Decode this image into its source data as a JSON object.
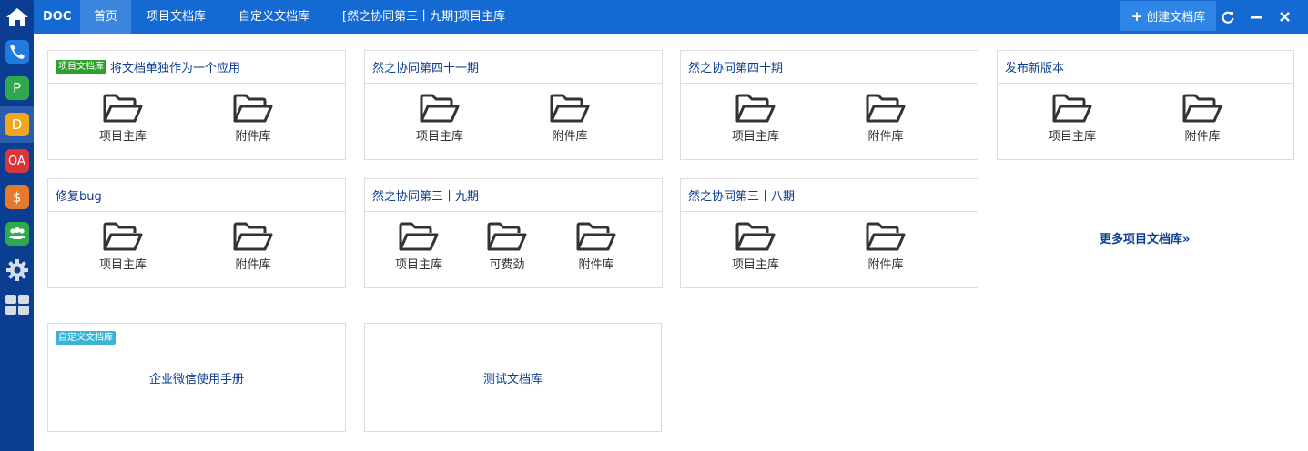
{
  "app": {
    "brand": "DOC"
  },
  "sidebar": {
    "items": [
      {
        "name": "home-icon",
        "label": ""
      },
      {
        "name": "phone-icon",
        "label": "",
        "color": "#1f7be0"
      },
      {
        "name": "p-app-icon",
        "label": "P",
        "color": "#2fa84f"
      },
      {
        "name": "d-app-icon",
        "label": "D",
        "color": "#f0a61e"
      },
      {
        "name": "oa-app-icon",
        "label": "OA",
        "color": "#d9363a"
      },
      {
        "name": "dollar-app-icon",
        "label": "$",
        "color": "#e67a2c"
      },
      {
        "name": "team-app-icon",
        "label": "",
        "color": "#2fa84f"
      },
      {
        "name": "gear-icon",
        "label": ""
      },
      {
        "name": "grid-icon",
        "label": ""
      }
    ]
  },
  "nav": {
    "tabs": [
      {
        "label": "首页",
        "active": true
      },
      {
        "label": "项目文档库",
        "active": false
      },
      {
        "label": "自定义文档库",
        "active": false
      },
      {
        "label": "[然之协同第三十九期]项目主库",
        "active": false
      }
    ],
    "create_label": "创建文档库"
  },
  "project_section": {
    "badge": "项目文档库",
    "cards": [
      {
        "title": "将文档单独作为一个应用",
        "libs": [
          "项目主库",
          "附件库"
        ]
      },
      {
        "title": "然之协同第四十一期",
        "libs": [
          "项目主库",
          "附件库"
        ]
      },
      {
        "title": "然之协同第四十期",
        "libs": [
          "项目主库",
          "附件库"
        ]
      },
      {
        "title": "发布新版本",
        "libs": [
          "项目主库",
          "附件库"
        ]
      },
      {
        "title": "修复bug",
        "libs": [
          "项目主库",
          "附件库"
        ]
      },
      {
        "title": "然之协同第三十九期",
        "libs": [
          "项目主库",
          "可费劲",
          "附件库"
        ]
      },
      {
        "title": "然之协同第三十八期",
        "libs": [
          "项目主库",
          "附件库"
        ]
      }
    ],
    "more_label": "更多项目文档库»"
  },
  "custom_section": {
    "badge": "自定义文档库",
    "cards": [
      {
        "title": "企业微信使用手册"
      },
      {
        "title": "测试文档库"
      }
    ]
  },
  "colors": {
    "topbar": "#1469d2",
    "sidebar": "#0b3d91",
    "badge_project": "#2ca02c",
    "badge_custom": "#3bb3d6"
  }
}
